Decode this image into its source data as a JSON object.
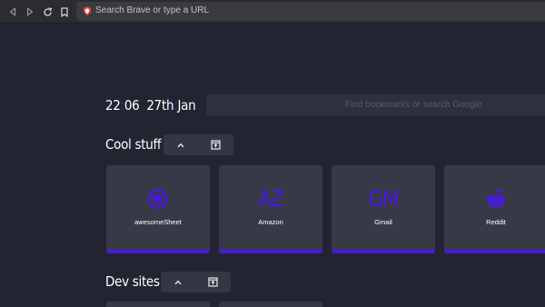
{
  "browser": {
    "url_placeholder": "Search Brave or type a URL",
    "icons": [
      "back-icon",
      "forward-icon",
      "reload-icon",
      "bookmark-icon",
      "brave-shield-icon"
    ]
  },
  "clock": {
    "hour": "22",
    "separator": ":",
    "minute": "06",
    "date": "27th",
    "month": "Jan"
  },
  "search": {
    "placeholder": "Find bookmarks or search Google"
  },
  "sections": [
    {
      "title": "Cool stuff",
      "controls": [
        "collapse",
        "open-all"
      ],
      "bookmarks": [
        {
          "label": "awesomeSheet",
          "icon": "awesomesheet-icon",
          "glyph": ""
        },
        {
          "label": "Amazon",
          "icon": "letters",
          "glyph": "AZ"
        },
        {
          "label": "Gmail",
          "icon": "letters",
          "glyph": "GM"
        },
        {
          "label": "Reddit",
          "icon": "reddit-icon",
          "glyph": ""
        }
      ]
    },
    {
      "title": "Dev sites",
      "controls": [
        "collapse",
        "open-all"
      ]
    }
  ],
  "colors": {
    "background": "#222431",
    "accent": "#4a18e0",
    "card": "#373947",
    "toolbar": "#2b2c30"
  }
}
